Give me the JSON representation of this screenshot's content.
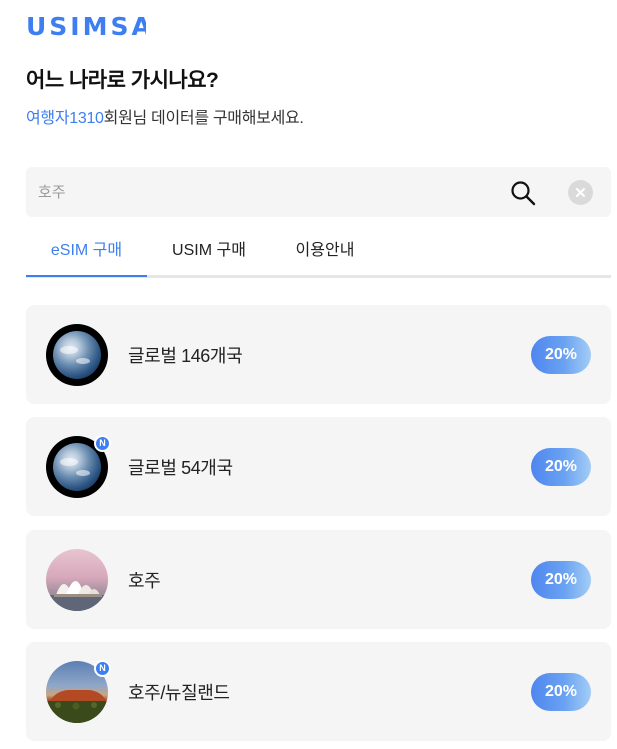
{
  "brand": {
    "logo_text": "USIMSA",
    "color": "#3d7ff0"
  },
  "heading": "어느 나라로 가시나요?",
  "subheading": {
    "username": "여행자1310",
    "suffix": "회원님 데이터를 구매해보세요."
  },
  "search": {
    "value": "",
    "placeholder": "호주",
    "icon": "search-icon",
    "clear_icon": "close-icon"
  },
  "tabs": [
    {
      "label": "eSIM 구매",
      "active": true
    },
    {
      "label": "USIM 구매",
      "active": false
    },
    {
      "label": "이용안내",
      "active": false
    }
  ],
  "products": [
    {
      "name": "글로벌 146개국",
      "discount": "20%",
      "image": "earth",
      "new": false
    },
    {
      "name": "글로벌 54개국",
      "discount": "20%",
      "image": "earth",
      "new": true,
      "badge": "N"
    },
    {
      "name": "호주",
      "discount": "20%",
      "image": "sydney-opera-house",
      "new": false
    },
    {
      "name": "호주/뉴질랜드",
      "discount": "20%",
      "image": "uluru",
      "new": true,
      "badge": "N"
    }
  ],
  "colors": {
    "accent": "#3d7ff0",
    "card_bg": "#f5f5f5"
  }
}
